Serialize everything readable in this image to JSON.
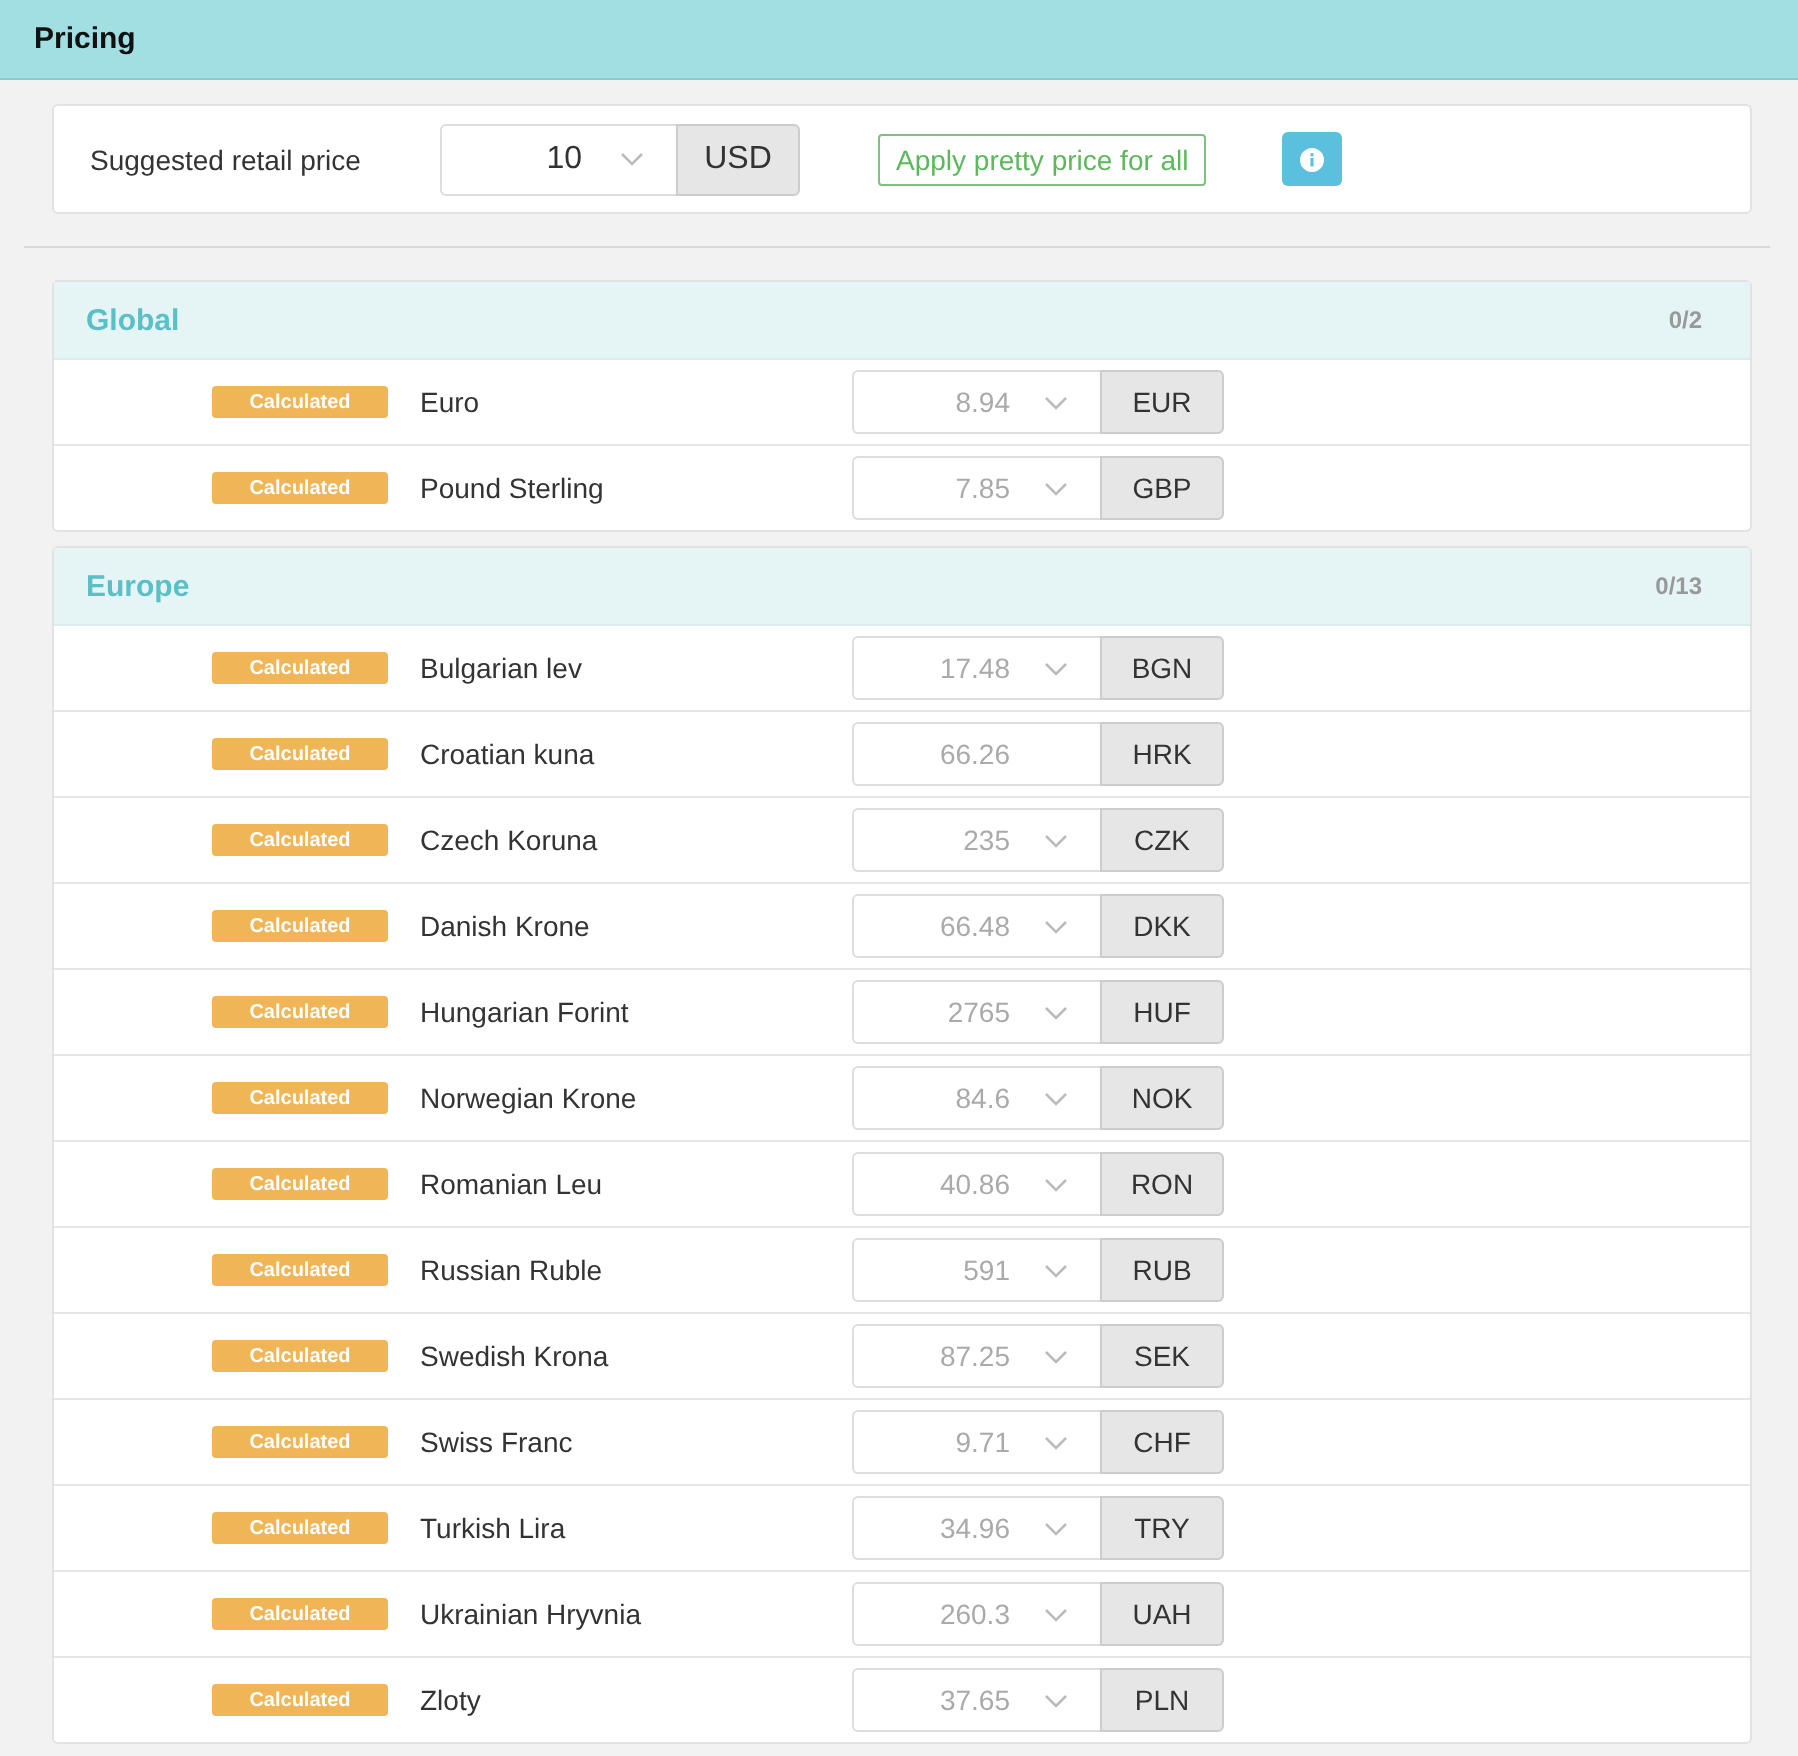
{
  "header": {
    "title": "Pricing"
  },
  "suggested": {
    "label": "Suggested retail price",
    "value": "10",
    "currency": "USD",
    "dropdown": true,
    "apply_button": "Apply pretty price for all"
  },
  "sections": [
    {
      "title": "Global",
      "count": "0/2",
      "rows": [
        {
          "status": "Calculated",
          "name": "Euro",
          "placeholder": "8.94",
          "currency": "EUR",
          "dropdown": true
        },
        {
          "status": "Calculated",
          "name": "Pound Sterling",
          "placeholder": "7.85",
          "currency": "GBP",
          "dropdown": true
        }
      ]
    },
    {
      "title": "Europe",
      "count": "0/13",
      "rows": [
        {
          "status": "Calculated",
          "name": "Bulgarian lev",
          "placeholder": "17.48",
          "currency": "BGN",
          "dropdown": true
        },
        {
          "status": "Calculated",
          "name": "Croatian kuna",
          "placeholder": "66.26",
          "currency": "HRK",
          "dropdown": false
        },
        {
          "status": "Calculated",
          "name": "Czech Koruna",
          "placeholder": "235",
          "currency": "CZK",
          "dropdown": true
        },
        {
          "status": "Calculated",
          "name": "Danish Krone",
          "placeholder": "66.48",
          "currency": "DKK",
          "dropdown": true
        },
        {
          "status": "Calculated",
          "name": "Hungarian Forint",
          "placeholder": "2765",
          "currency": "HUF",
          "dropdown": true
        },
        {
          "status": "Calculated",
          "name": "Norwegian Krone",
          "placeholder": "84.6",
          "currency": "NOK",
          "dropdown": true
        },
        {
          "status": "Calculated",
          "name": "Romanian Leu",
          "placeholder": "40.86",
          "currency": "RON",
          "dropdown": true
        },
        {
          "status": "Calculated",
          "name": "Russian Ruble",
          "placeholder": "591",
          "currency": "RUB",
          "dropdown": true
        },
        {
          "status": "Calculated",
          "name": "Swedish Krona",
          "placeholder": "87.25",
          "currency": "SEK",
          "dropdown": true
        },
        {
          "status": "Calculated",
          "name": "Swiss Franc",
          "placeholder": "9.71",
          "currency": "CHF",
          "dropdown": true
        },
        {
          "status": "Calculated",
          "name": "Turkish Lira",
          "placeholder": "34.96",
          "currency": "TRY",
          "dropdown": true
        },
        {
          "status": "Calculated",
          "name": "Ukrainian Hryvnia",
          "placeholder": "260.3",
          "currency": "UAH",
          "dropdown": true
        },
        {
          "status": "Calculated",
          "name": "Zloty",
          "placeholder": "37.65",
          "currency": "PLN",
          "dropdown": true
        }
      ]
    }
  ]
}
